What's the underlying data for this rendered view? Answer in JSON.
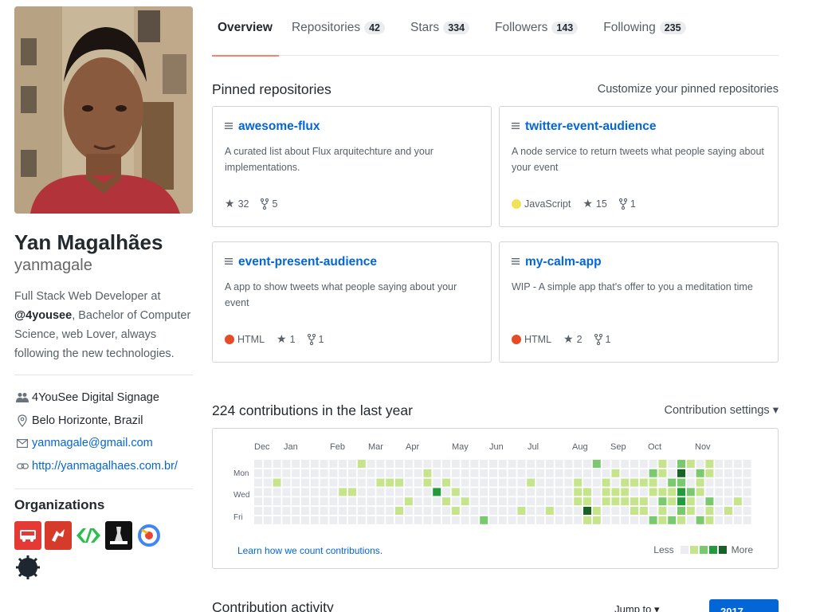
{
  "profile": {
    "fullname": "Yan Magalhães",
    "username": "yanmagale",
    "bio_pre": "Full Stack Web Developer at ",
    "bio_org": "@4yousee",
    "bio_post": ", Bachelor of Computer Science, web Lover, always following the new technologies.",
    "company": "4YouSee Digital Signage",
    "location": "Belo Horizonte, Brazil",
    "email": "yanmagale@gmail.com",
    "website": "http://yanmagalhaes.com.br/",
    "orgs_title": "Organizations"
  },
  "tabs": [
    {
      "label": "Overview",
      "count": ""
    },
    {
      "label": "Repositories",
      "count": "42"
    },
    {
      "label": "Stars",
      "count": "334"
    },
    {
      "label": "Followers",
      "count": "143"
    },
    {
      "label": "Following",
      "count": "235"
    }
  ],
  "pinned": {
    "title": "Pinned repositories",
    "customize": "Customize your pinned repositories",
    "repos": [
      {
        "name": "awesome-flux",
        "desc": "A curated list about Flux arquitechture and your implementations.",
        "lang": "",
        "lang_color": "",
        "stars": "32",
        "forks": "5"
      },
      {
        "name": "twitter-event-audience",
        "desc": "A node service to return tweets what people saying about your event",
        "lang": "JavaScript",
        "lang_color": "#f1e05a",
        "stars": "15",
        "forks": "1"
      },
      {
        "name": "event-present-audience",
        "desc": "A app to show tweets what people saying about your event",
        "lang": "HTML",
        "lang_color": "#e34c26",
        "stars": "1",
        "forks": "1"
      },
      {
        "name": "my-calm-app",
        "desc": "WIP - A simple app that's offer to you a meditation time",
        "lang": "HTML",
        "lang_color": "#e34c26",
        "stars": "2",
        "forks": "1"
      }
    ]
  },
  "contrib": {
    "title": "224 contributions in the last year",
    "settings": "Contribution settings ▾",
    "months": [
      "Dec",
      "Jan",
      "Feb",
      "Mar",
      "Apr",
      "May",
      "Jun",
      "Jul",
      "Aug",
      "Sep",
      "Oct",
      "Nov"
    ],
    "weekdays": [
      "Mon",
      "Wed",
      "Fri"
    ],
    "learn": "Learn how we count contributions.",
    "less": "Less",
    "more": "More",
    "colors": [
      "#ebedf0",
      "#c6e48b",
      "#7bc96f",
      "#239a3b",
      "#196127"
    ]
  },
  "activity": {
    "title": "Contribution activity",
    "jump": "Jump to ▾",
    "year": "2017"
  }
}
